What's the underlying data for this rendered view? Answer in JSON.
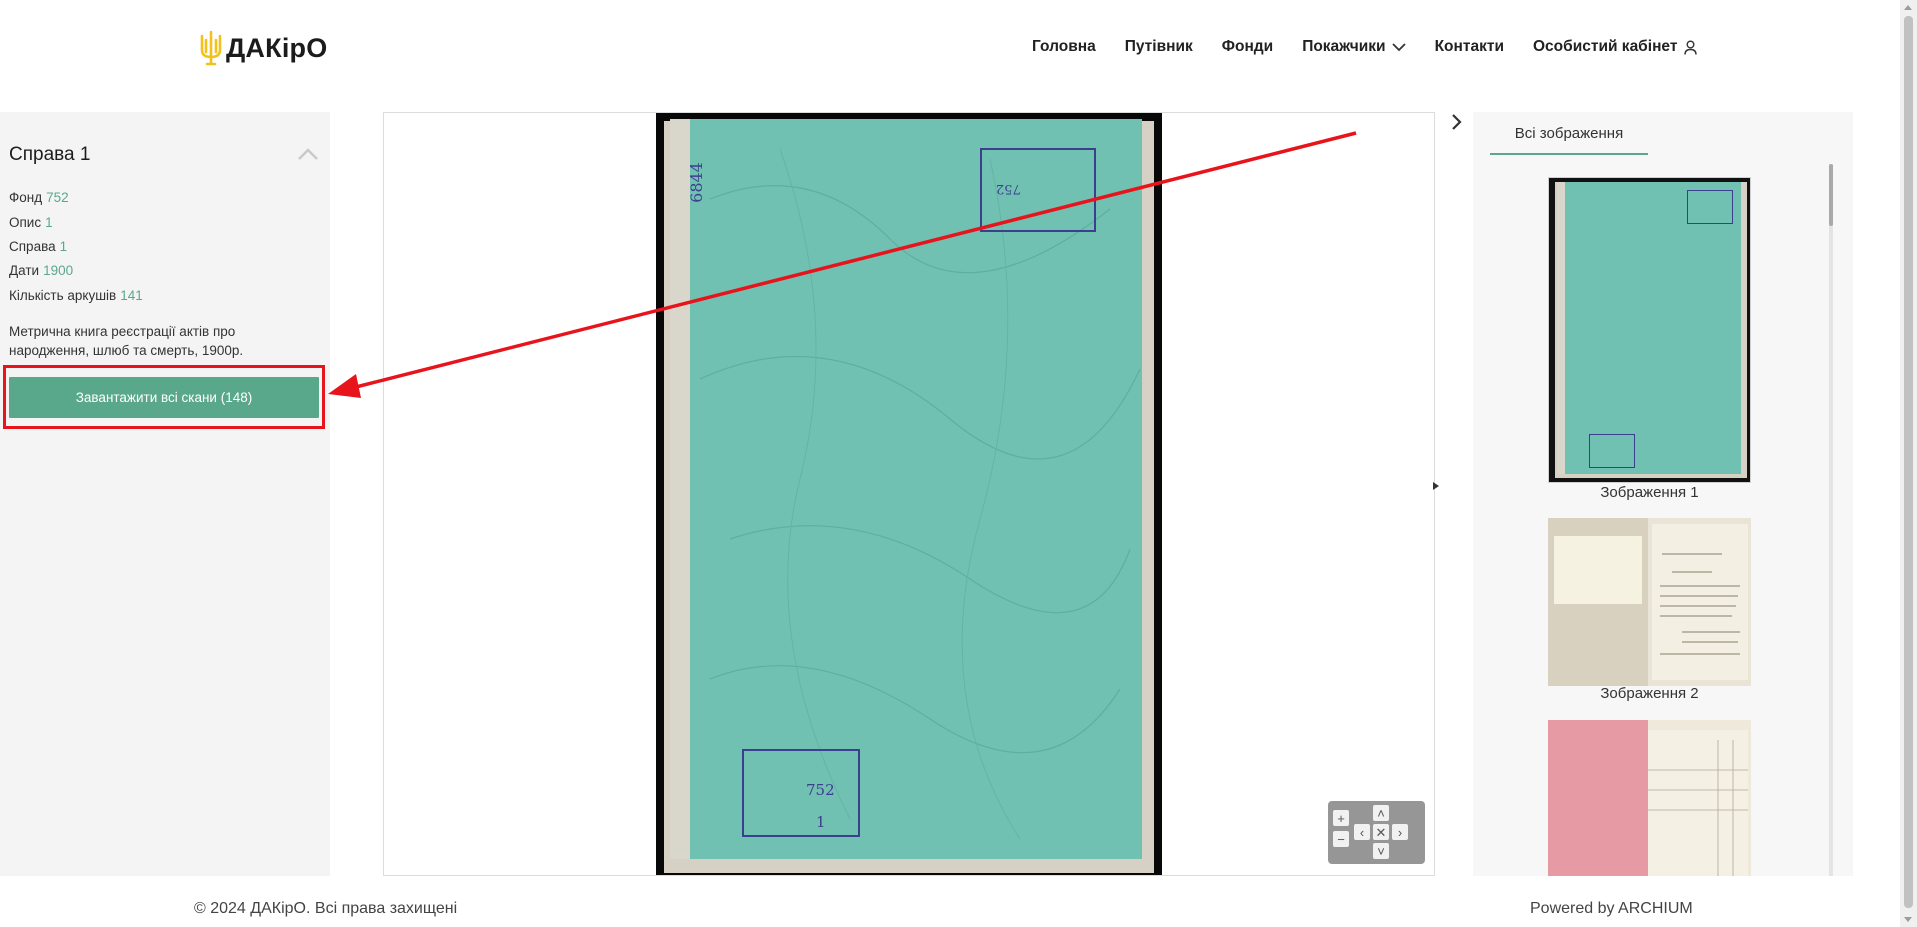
{
  "header": {
    "logo_text": "ДАКірО",
    "nav": [
      {
        "label": "Головна"
      },
      {
        "label": "Путівник"
      },
      {
        "label": "Фонди"
      },
      {
        "label": "Покажчики"
      },
      {
        "label": "Контакти"
      },
      {
        "label": "Особистий кабінет"
      }
    ]
  },
  "case": {
    "title": "Справа 1",
    "meta": [
      {
        "label": "Фонд",
        "value": "752"
      },
      {
        "label": "Опис",
        "value": "1"
      },
      {
        "label": "Справа",
        "value": "1"
      },
      {
        "label": "Дати",
        "value": "1900"
      },
      {
        "label": "Кількість аркушів",
        "value": "141"
      }
    ],
    "description": "Метрична книга реєстрації актів про народження, шлюб та смерть, 1900р.",
    "download_button": "Завантажити всі скани (148)"
  },
  "viewer": {
    "stamp_top_number": "752",
    "stamp_bottom_number": "752",
    "stamp_bottom_sub": "1",
    "spine_text": "6844"
  },
  "gallery": {
    "tab_label": "Всі зображення",
    "thumbnails": [
      {
        "label": "Зображення 1"
      },
      {
        "label": "Зображення 2"
      },
      {
        "label": ""
      }
    ]
  },
  "footer": {
    "copyright": "© 2024 ДАКірО. Всі права захищені",
    "powered": "Powered by ARCHIUM"
  },
  "colors": {
    "accent": "#5aa88c",
    "annotation": "#e8141c",
    "cover": "#71c1b3"
  }
}
